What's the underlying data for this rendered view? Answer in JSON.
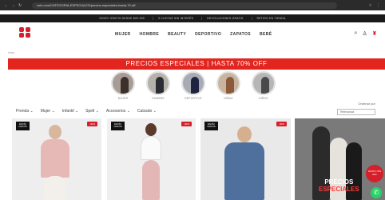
{
  "browser": {
    "back": "←",
    "forward": "→",
    "reload": "↻",
    "url": "cuts.com/CATEGORIA-ESPECIALES/precios-especiales-hasta-70-off",
    "star": "☆",
    "menu": "⋮"
  },
  "promo_bar": [
    "ENVÍO GRATIS DESDE $29.999",
    "3 CUOTAS SIN INTERÉS",
    "DEVOLUCIONES GRATIS",
    "RETIRO EN TIENDA"
  ],
  "header": {
    "menu": [
      "MUJER",
      "HOMBRE",
      "BEAUTY",
      "DEPORTIVO",
      "ZAPATOS",
      "BEBÉ"
    ],
    "icons": {
      "search": "⌕",
      "account": "♙",
      "bag": "♜"
    }
  },
  "breadcrumb": "Inicio",
  "banner": "PRECIOS ESPECIALES | HASTA 70% OFF",
  "categories": [
    {
      "label": "MUJER"
    },
    {
      "label": "HOMBRE"
    },
    {
      "label": "DEPORTIVO"
    },
    {
      "label": "NIÑAS"
    },
    {
      "label": "NIÑOS"
    }
  ],
  "filters": [
    "Prenda",
    "Mujer",
    "Infantil",
    "Spell",
    "Accesorios",
    "Calzado"
  ],
  "sort": {
    "label": "Ordenar por",
    "value": "Relevancia"
  },
  "products": [
    {
      "badge": "ENVÍO GRATIS",
      "discount": "-30%"
    },
    {
      "badge": "ENVÍO GRATIS",
      "discount": "-40%"
    },
    {
      "badge": "ENVÍO GRATIS",
      "discount": "-30%"
    }
  ],
  "promo_card": {
    "line1": "PRECIOS",
    "line2": "ESPECIALES",
    "sticker": "HASTA 70% OFF"
  },
  "colors": {
    "brand_red": "#d51f2a",
    "banner_red": "#e2261f",
    "whatsapp": "#25d366"
  }
}
